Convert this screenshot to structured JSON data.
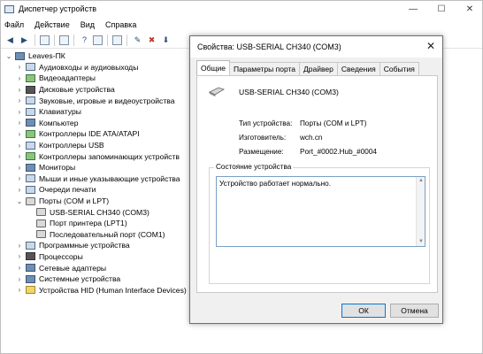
{
  "window": {
    "title": "Диспетчер устройств",
    "controls": [
      "—",
      "☐",
      "✕"
    ]
  },
  "menu": [
    "Файл",
    "Действие",
    "Вид",
    "Справка"
  ],
  "tree": {
    "root": "Leaves-ПК",
    "categories": [
      {
        "label": "Аудиовходы и аудиовыходы",
        "expander": "›",
        "icon": "audio-icon"
      },
      {
        "label": "Видеоадаптеры",
        "expander": "›",
        "icon": "display-adapter-icon"
      },
      {
        "label": "Дисковые устройства",
        "expander": "›",
        "icon": "disk-icon"
      },
      {
        "label": "Звуковые, игровые и видеоустройства",
        "expander": "›",
        "icon": "sound-icon"
      },
      {
        "label": "Клавиатуры",
        "expander": "›",
        "icon": "keyboard-icon"
      },
      {
        "label": "Компьютер",
        "expander": "›",
        "icon": "computer-icon"
      },
      {
        "label": "Контроллеры IDE ATA/ATAPI",
        "expander": "›",
        "icon": "ide-icon"
      },
      {
        "label": "Контроллеры USB",
        "expander": "›",
        "icon": "usb-icon"
      },
      {
        "label": "Контроллеры запоминающих устройств",
        "expander": "›",
        "icon": "storage-icon"
      },
      {
        "label": "Мониторы",
        "expander": "›",
        "icon": "monitor-icon"
      },
      {
        "label": "Мыши и иные указывающие устройства",
        "expander": "›",
        "icon": "mouse-icon"
      },
      {
        "label": "Очереди печати",
        "expander": "›",
        "icon": "printer-icon"
      },
      {
        "label": "Порты (COM и LPT)",
        "expander": "⌄",
        "icon": "port-icon"
      }
    ],
    "ports_children": [
      "USB-SERIAL CH340 (COM3)",
      "Порт принтера (LPT1)",
      "Последовательный порт (COM1)"
    ],
    "categories_after": [
      {
        "label": "Программные устройства",
        "expander": "›",
        "icon": "software-device-icon"
      },
      {
        "label": "Процессоры",
        "expander": "›",
        "icon": "processor-icon"
      },
      {
        "label": "Сетевые адаптеры",
        "expander": "›",
        "icon": "network-icon"
      },
      {
        "label": "Системные устройства",
        "expander": "›",
        "icon": "system-icon"
      },
      {
        "label": "Устройства HID (Human Interface Devices)",
        "expander": "›",
        "icon": "hid-icon"
      }
    ]
  },
  "dialog": {
    "title": "Свойства: USB-SERIAL CH340 (COM3)",
    "close": "✕",
    "tabs": [
      "Общие",
      "Параметры порта",
      "Драйвер",
      "Сведения",
      "События"
    ],
    "device_name": "USB-SERIAL CH340 (COM3)",
    "props": [
      {
        "label": "Тип устройства:",
        "value": "Порты (COM и LPT)"
      },
      {
        "label": "Изготовитель:",
        "value": "wch.cn"
      },
      {
        "label": "Размещение:",
        "value": "Port_#0002.Hub_#0004"
      }
    ],
    "status_legend": "Состояние устройства",
    "status_text": "Устройство работает нормально.",
    "ok": "ОК",
    "cancel": "Отмена"
  }
}
